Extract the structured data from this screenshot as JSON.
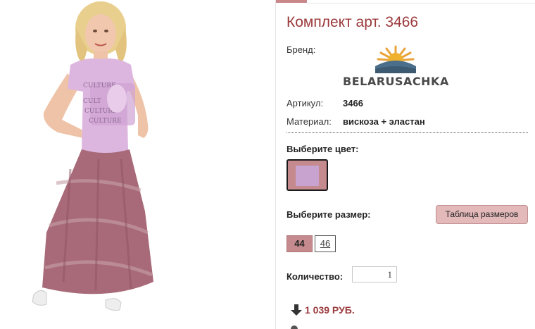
{
  "product": {
    "title": "Комплект арт. 3466",
    "brand_label": "Бренд:",
    "brand_name": "BELARUSACHKA",
    "article_label": "Артикул:",
    "article_value": "3466",
    "material_label": "Материал:",
    "material_value": "вискоза + эластан",
    "photo_icon": "model-photo"
  },
  "color": {
    "label": "Выберите цвет:",
    "swatch_outer": "#c48a8d",
    "swatch_inner": "#c9a3cf"
  },
  "size": {
    "label": "Выберите размер:",
    "table_button": "Таблица размеров",
    "options": [
      {
        "label": "44",
        "selected": true
      },
      {
        "label": "46",
        "selected": false
      }
    ]
  },
  "quantity": {
    "label": "Количество:",
    "value": "1"
  },
  "price": {
    "text": "1 039 РУБ.",
    "icon": "arrow-down-icon"
  },
  "colors": {
    "accent": "#9b3a3c",
    "accent_light": "#c48a8d",
    "button_bg": "#e3b9ba"
  }
}
